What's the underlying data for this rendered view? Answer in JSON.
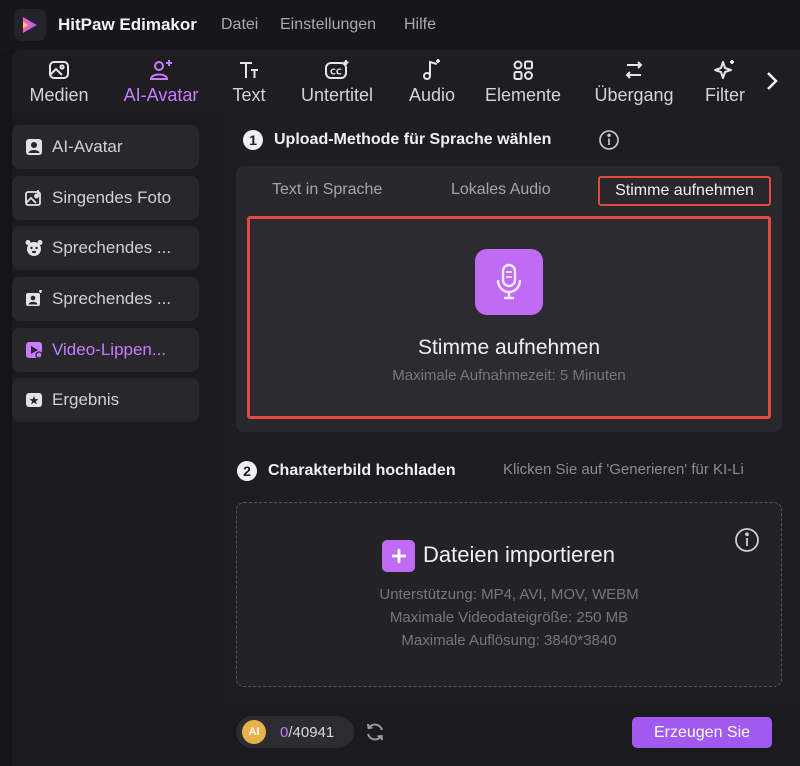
{
  "app": {
    "title": "HitPaw Edimakor",
    "menu": [
      "Datei",
      "Einstellungen",
      "Hilfe"
    ]
  },
  "toolbar": {
    "items": [
      {
        "label": "Medien",
        "icon": "media-icon"
      },
      {
        "label": "AI-Avatar",
        "icon": "avatar-icon",
        "active": true
      },
      {
        "label": "Text",
        "icon": "text-icon"
      },
      {
        "label": "Untertitel",
        "icon": "subtitle-icon"
      },
      {
        "label": "Audio",
        "icon": "music-note-icon"
      },
      {
        "label": "Elemente",
        "icon": "elements-icon"
      },
      {
        "label": "Übergang",
        "icon": "transition-icon"
      },
      {
        "label": "Filter",
        "icon": "sparkle-icon"
      }
    ]
  },
  "sidebar": {
    "items": [
      {
        "label": "AI-Avatar",
        "icon": "avatar-card-icon"
      },
      {
        "label": "Singendes Foto",
        "icon": "photo-music-icon"
      },
      {
        "label": "Sprechendes ...",
        "icon": "talking-pet-icon"
      },
      {
        "label": "Sprechendes ...",
        "icon": "talking-photo-icon"
      },
      {
        "label": "Video-Lippen...",
        "icon": "video-lip-icon",
        "active": true
      },
      {
        "label": "Ergebnis",
        "icon": "result-icon"
      }
    ]
  },
  "step1": {
    "number": "1",
    "title": "Upload-Methode für Sprache wählen",
    "tabs": [
      "Text in Sprache",
      "Lokales Audio",
      "Stimme aufnehmen"
    ],
    "record_title": "Stimme aufnehmen",
    "record_subtitle": "Maximale Aufnahmezeit: 5 Minuten"
  },
  "step2": {
    "number": "2",
    "title": "Charakterbild hochladen",
    "hint": "Klicken Sie auf 'Generieren' für KI-Li",
    "import_label": "Dateien importieren",
    "info_lines": [
      "Unterstützung: MP4, AVI, MOV, WEBM",
      "Maximale Videodateigröße: 250 MB",
      "Maximale Auflösung: 3840*3840"
    ]
  },
  "footer": {
    "coin_label": "AI",
    "credits_used": "0",
    "credits_total": "/40941",
    "generate_label": "Erzeugen Sie"
  },
  "colors": {
    "accent": "#c77dff",
    "accent_button": "#a259f0",
    "highlight_border": "#e04a3f"
  }
}
